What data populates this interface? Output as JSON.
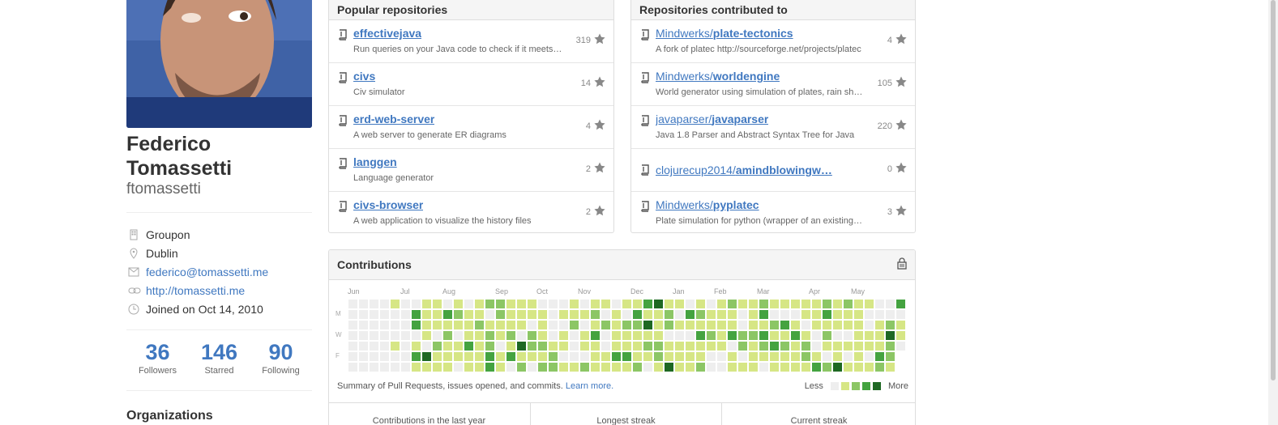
{
  "profile": {
    "name": "Federico Tomassetti",
    "username": "ftomassetti",
    "details": [
      {
        "icon": "organization-icon",
        "text": "Groupon",
        "link": false
      },
      {
        "icon": "location-icon",
        "text": "Dublin",
        "link": false
      },
      {
        "icon": "mail-icon",
        "text": "federico@tomassetti.me",
        "link": true
      },
      {
        "icon": "link-icon",
        "text": "http://tomassetti.me",
        "link": true
      },
      {
        "icon": "clock-icon",
        "text": "Joined on Oct 14, 2010",
        "link": false
      }
    ],
    "stats": [
      {
        "value": "36",
        "label": "Followers"
      },
      {
        "value": "146",
        "label": "Starred"
      },
      {
        "value": "90",
        "label": "Following"
      }
    ],
    "organizations_title": "Organizations"
  },
  "popular": {
    "title": "Popular repositories",
    "repos": [
      {
        "owner": "",
        "name": "effectivejava",
        "desc": "Run queries on your Java code to check if it meets the criteria",
        "stars": "319"
      },
      {
        "owner": "",
        "name": "civs",
        "desc": "Civ simulator",
        "stars": "14"
      },
      {
        "owner": "",
        "name": "erd-web-server",
        "desc": "A web server to generate ER diagrams",
        "stars": "4"
      },
      {
        "owner": "",
        "name": "langgen",
        "desc": "Language generator",
        "stars": "2"
      },
      {
        "owner": "",
        "name": "civs-browser",
        "desc": "A web application to visualize the history files",
        "stars": "2"
      }
    ]
  },
  "contributed": {
    "title": "Repositories contributed to",
    "repos": [
      {
        "owner": "Mindwerks/",
        "name": "plate-tectonics",
        "desc": "A fork of platec http://sourceforge.net/projects/platec",
        "stars": "4"
      },
      {
        "owner": "Mindwerks/",
        "name": "worldengine",
        "desc": "World generator using simulation of plates, rain shadow",
        "stars": "105"
      },
      {
        "owner": "javaparser/",
        "name": "javaparser",
        "desc": "Java 1.8 Parser and Abstract Syntax Tree for Java",
        "stars": "220"
      },
      {
        "owner": "clojurecup2014/",
        "name": "amindblowingw…",
        "desc": "",
        "stars": "0"
      },
      {
        "owner": "Mindwerks/",
        "name": "pyplatec",
        "desc": "Plate simulation for python (wrapper of an existing C library)",
        "stars": "3"
      }
    ]
  },
  "contributions": {
    "title": "Contributions",
    "months": [
      "Jun",
      "Jul",
      "Aug",
      "Sep",
      "Oct",
      "Nov",
      "Dec",
      "Jan",
      "Feb",
      "Mar",
      "Apr",
      "May"
    ],
    "days": [
      "M",
      "W",
      "F"
    ],
    "summary": "Summary of Pull Requests, issues opened, and commits.",
    "learn_more": "Learn more.",
    "legend_less": "Less",
    "legend_more": "More",
    "colors": [
      "#eeeeee",
      "#d6e685",
      "#8cc665",
      "#44a340",
      "#1e6823"
    ],
    "tabs": [
      "Contributions in the last year",
      "Longest streak",
      "Current streak"
    ]
  }
}
